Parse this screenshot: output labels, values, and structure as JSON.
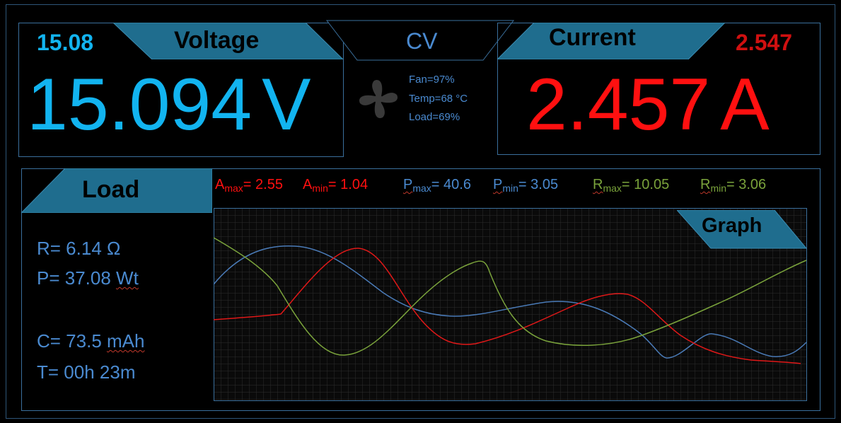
{
  "voltage": {
    "title": "Voltage",
    "setpoint": "15.08",
    "value": "15.094",
    "unit": "V"
  },
  "mode": {
    "label": "CV"
  },
  "status": {
    "fan": "Fan=97%",
    "temp": "Temp=68 °C",
    "load": "Load=69%"
  },
  "current": {
    "title": "Current",
    "setpoint": "2.547",
    "value": "2.457",
    "unit": "A"
  },
  "load": {
    "title": "Load",
    "r": "R= 6.14 Ω",
    "p_prefix": "P= 37.08 ",
    "p_unit": "Wt",
    "c_prefix": "C= 73.5 ",
    "c_unit": "mAh",
    "t": "T= 00h 23m"
  },
  "stats": {
    "a_sym": "A",
    "a_max_sub": "max",
    "a_max_val": "= 2.55",
    "a_min_sub": "min",
    "a_min_val": "= 1.04",
    "p_sym": "P",
    "p_max_sub": "max",
    "p_max_val": "= 40.6",
    "p_min_sub": "min",
    "p_min_val": "= 3.05",
    "r_sym": "R",
    "r_max_sub": "max",
    "r_max_val": "= 10.05",
    "r_min_sub": "min",
    "r_min_val": "= 3.06"
  },
  "graph": {
    "title": "Graph"
  },
  "colors": {
    "cyan": "#12b4f0",
    "red": "#ff1010",
    "blue": "#3f7bbf",
    "green": "#7aa33b",
    "tab": "#1f6d8e"
  },
  "icons": {
    "fan": "fan-icon"
  }
}
